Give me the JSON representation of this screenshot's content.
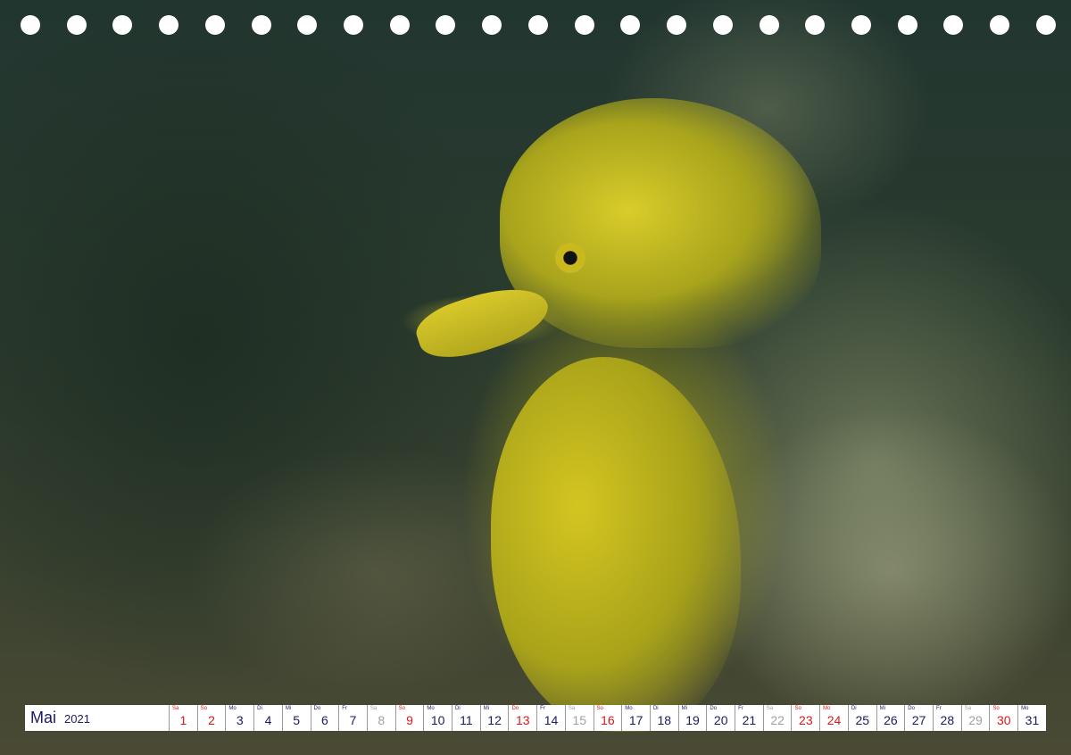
{
  "calendar": {
    "month": "Mai",
    "year": "2021",
    "colors": {
      "weekday": "#1b1b5e",
      "sunday": "#d51a1a",
      "saturday": "#a0a0a0"
    },
    "days": [
      {
        "abbr": "Sa",
        "num": "1",
        "type": "sun"
      },
      {
        "abbr": "So",
        "num": "2",
        "type": "sun"
      },
      {
        "abbr": "Mo",
        "num": "3",
        "type": "weekday"
      },
      {
        "abbr": "Di",
        "num": "4",
        "type": "weekday"
      },
      {
        "abbr": "Mi",
        "num": "5",
        "type": "weekday"
      },
      {
        "abbr": "Do",
        "num": "6",
        "type": "weekday"
      },
      {
        "abbr": "Fr",
        "num": "7",
        "type": "weekday"
      },
      {
        "abbr": "Sa",
        "num": "8",
        "type": "sat"
      },
      {
        "abbr": "So",
        "num": "9",
        "type": "sun"
      },
      {
        "abbr": "Mo",
        "num": "10",
        "type": "weekday"
      },
      {
        "abbr": "Di",
        "num": "11",
        "type": "weekday"
      },
      {
        "abbr": "Mi",
        "num": "12",
        "type": "weekday"
      },
      {
        "abbr": "Do",
        "num": "13",
        "type": "sun"
      },
      {
        "abbr": "Fr",
        "num": "14",
        "type": "weekday"
      },
      {
        "abbr": "Sa",
        "num": "15",
        "type": "sat"
      },
      {
        "abbr": "So",
        "num": "16",
        "type": "sun"
      },
      {
        "abbr": "Mo",
        "num": "17",
        "type": "weekday"
      },
      {
        "abbr": "Di",
        "num": "18",
        "type": "weekday"
      },
      {
        "abbr": "Mi",
        "num": "19",
        "type": "weekday"
      },
      {
        "abbr": "Do",
        "num": "20",
        "type": "weekday"
      },
      {
        "abbr": "Fr",
        "num": "21",
        "type": "weekday"
      },
      {
        "abbr": "Sa",
        "num": "22",
        "type": "sat"
      },
      {
        "abbr": "So",
        "num": "23",
        "type": "sun"
      },
      {
        "abbr": "Mo",
        "num": "24",
        "type": "sun"
      },
      {
        "abbr": "Di",
        "num": "25",
        "type": "weekday"
      },
      {
        "abbr": "Mi",
        "num": "26",
        "type": "weekday"
      },
      {
        "abbr": "Do",
        "num": "27",
        "type": "weekday"
      },
      {
        "abbr": "Fr",
        "num": "28",
        "type": "weekday"
      },
      {
        "abbr": "Sa",
        "num": "29",
        "type": "sat"
      },
      {
        "abbr": "So",
        "num": "30",
        "type": "sun"
      },
      {
        "abbr": "Mo",
        "num": "31",
        "type": "weekday"
      }
    ]
  }
}
